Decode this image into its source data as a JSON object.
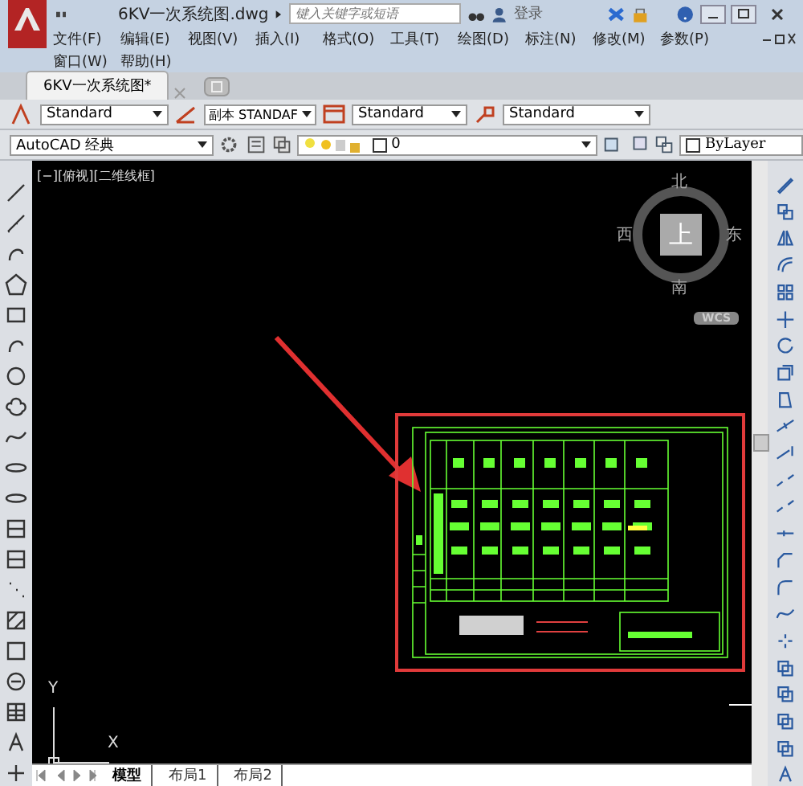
{
  "title_bar": {
    "file_name": "6KV一次系统图.dwg",
    "search": {
      "placeholder": "键入关键字或短语"
    },
    "login": "登录"
  },
  "menu_rows": [
    [
      "文件(F)",
      "编辑(E)",
      "视图(V)",
      "插入(I)",
      "格式(O)",
      "工具(T)",
      "绘图(D)",
      "标注(N)",
      "修改(M)",
      "参数(P)"
    ],
    [
      "窗口(W)",
      "帮助(H)"
    ]
  ],
  "doc_tabs": [
    {
      "label": "6KV一次系统图*",
      "selected": true
    }
  ],
  "style_toolbar": [
    "Standard",
    "副本 STANDAF",
    "Standard",
    "Standard"
  ],
  "layer_toolbar": {
    "workspace": "AutoCAD 经典",
    "layer": "0",
    "linetype": "ByLayer"
  },
  "viewport": {
    "label": "[−][俯视][二维线框]",
    "viewcube": {
      "north": "北",
      "south": "南",
      "east": "东",
      "west": "西",
      "top": "上",
      "wcs": "WCS"
    },
    "ucs": {
      "y": "Y",
      "x": "X"
    }
  },
  "layout_tabs": [
    {
      "label": "模型",
      "selected": true
    },
    {
      "label": "布局1",
      "selected": false
    },
    {
      "label": "布局2",
      "selected": false
    }
  ]
}
